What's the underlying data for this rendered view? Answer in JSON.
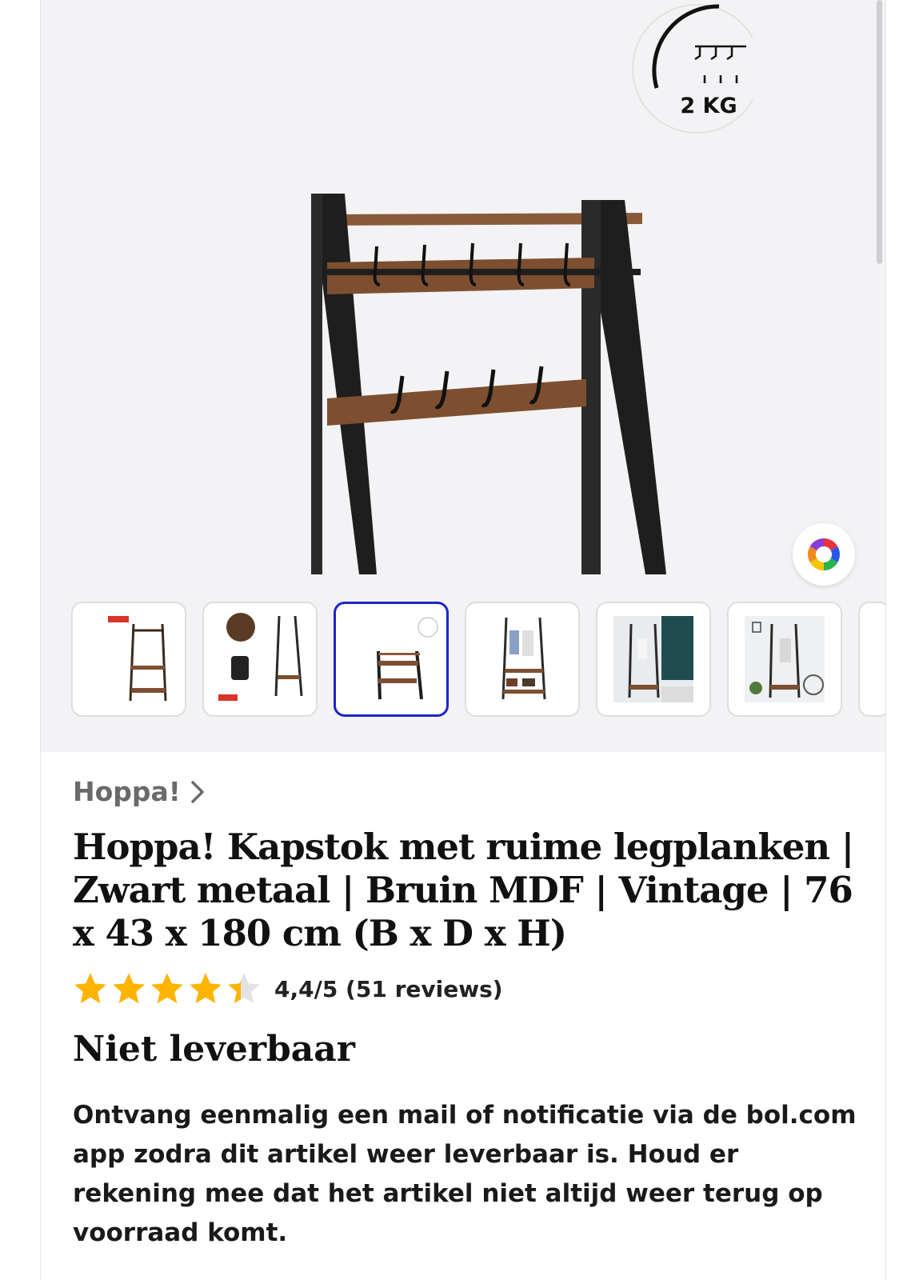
{
  "gallery": {
    "load_badge_text": "2 KG",
    "color_picker_icon": "color-wheel-icon",
    "thumbnails": [
      {
        "label": "product thumbnail 1"
      },
      {
        "label": "product thumbnail 2"
      },
      {
        "label": "product thumbnail 3",
        "selected": true
      },
      {
        "label": "product thumbnail 4"
      },
      {
        "label": "product thumbnail 5"
      },
      {
        "label": "product thumbnail 6"
      }
    ]
  },
  "product": {
    "brand": "Hoppa!",
    "brand_chevron_icon": "chevron-right-icon",
    "title": "Hoppa! Kapstok met ruime legplanken | Zwart metaal | Bruin MDF | Vintage | 76 x 43 x 180 cm (B x D x H)",
    "rating": {
      "value": 4.4,
      "max": 5,
      "text": "4,4/5 (51 reviews)",
      "star_color": "#ffb400",
      "empty_star_color": "#e3e3e3"
    },
    "availability": "Niet leverbaar",
    "notify_text": "Ontvang eenmalig een mail of notificatie via de bol.com app zodra dit artikel weer leverbaar is. Houd er rekening mee dat het artikel niet altijd weer terug op voorraad komt."
  },
  "colors": {
    "selected_thumbnail_border": "#1a27c9",
    "gallery_background": "#f3f3f5"
  }
}
